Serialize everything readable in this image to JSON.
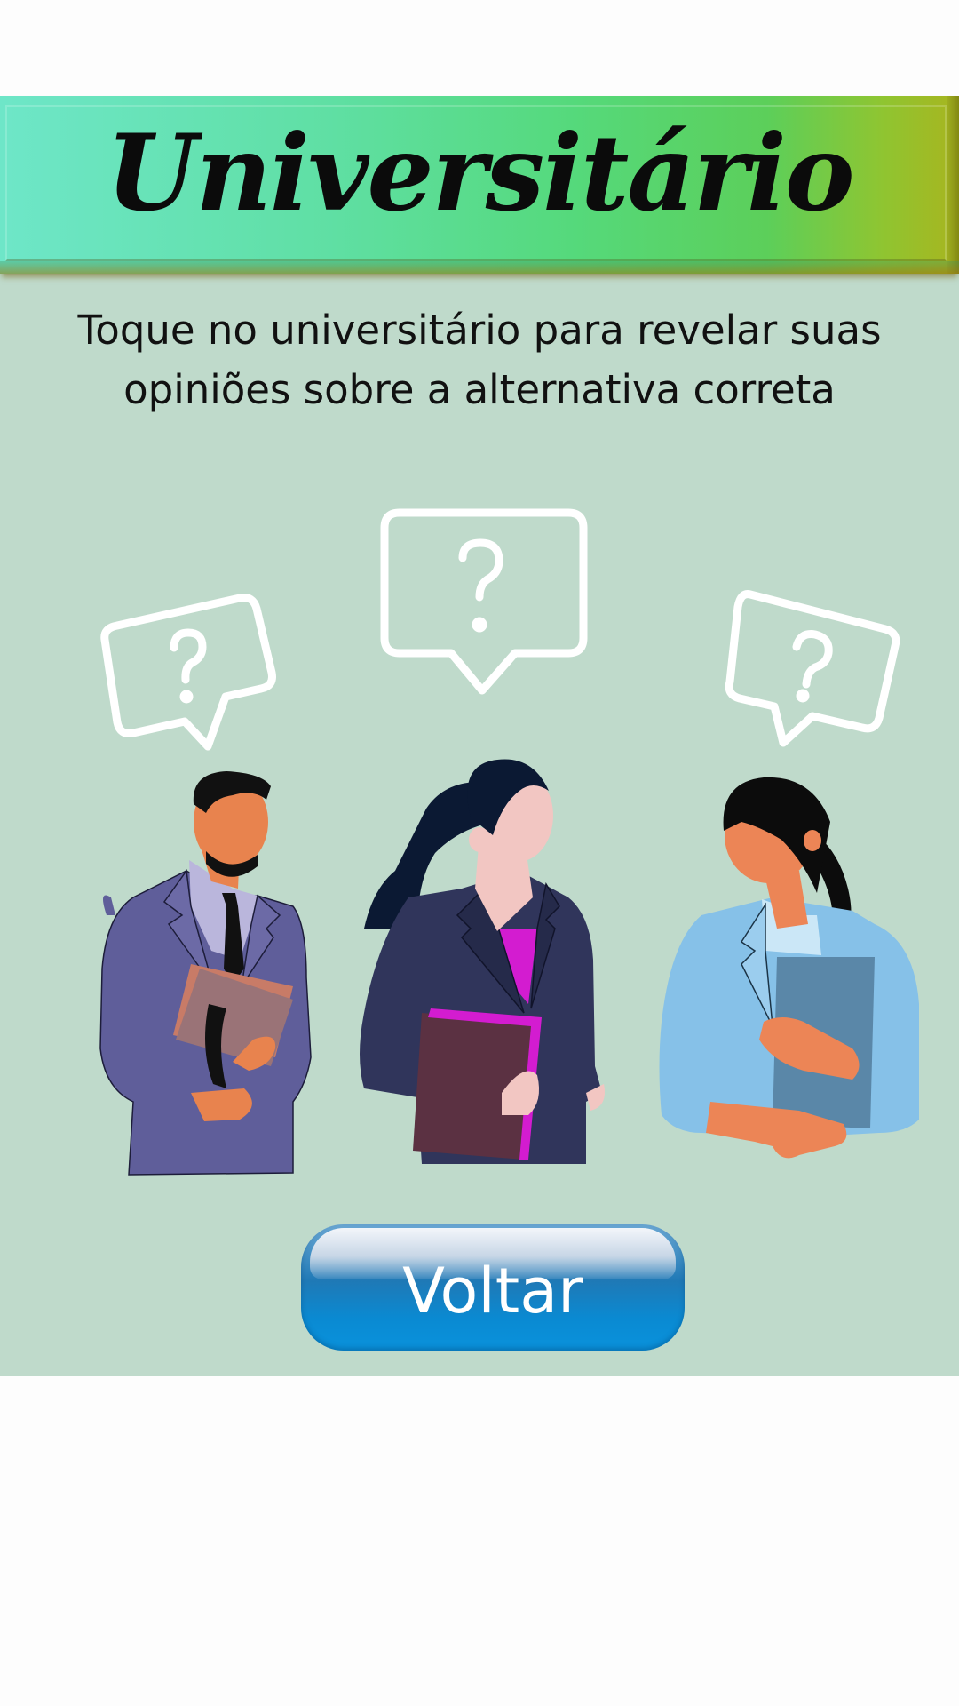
{
  "header": {
    "title": "Universitário"
  },
  "instruction": {
    "text": "Toque no universitário para revelar suas  opiniões sobre a alternativa correta"
  },
  "students": [
    {
      "name": "student-man",
      "icon": "question-bubble-icon"
    },
    {
      "name": "student-woman-center",
      "icon": "question-bubble-icon"
    },
    {
      "name": "student-woman-right",
      "icon": "question-bubble-icon"
    }
  ],
  "back_button": {
    "label": "Voltar"
  },
  "colors": {
    "background": "#bfdacb",
    "banner_start": "#6ee6c8",
    "banner_end": "#a8b51f",
    "button": "#0a8ad2"
  }
}
